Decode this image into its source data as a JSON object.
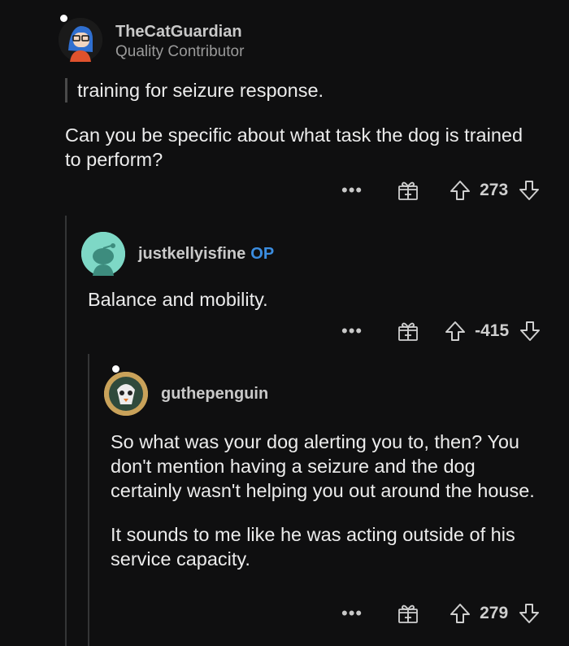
{
  "comments": [
    {
      "username": "TheCatGuardian",
      "flair": "Quality Contributor",
      "quote": "training for seizure response.",
      "paragraphs": [
        "Can you be specific about what task the dog is trained to perform?"
      ],
      "score": "273"
    },
    {
      "username": "justkellyisfine",
      "op_badge": "OP",
      "paragraphs": [
        "Balance and mobility."
      ],
      "score": "-415"
    },
    {
      "username": "guthepenguin",
      "paragraphs": [
        "So what was your dog alerting you to, then? You don't mention having a seizure and the dog certainly wasn't helping you out around the house.",
        "It sounds to me like he was acting outside of his service capacity."
      ],
      "score": "279"
    }
  ],
  "actions": {
    "more_label": "•••",
    "award_icon": "gift-icon",
    "upvote_icon": "arrow-up-icon",
    "downvote_icon": "arrow-down-icon"
  },
  "colors": {
    "background": "#0f0f10",
    "op_badge": "#3b8de0",
    "avatar_default": "#7ed8c6"
  }
}
